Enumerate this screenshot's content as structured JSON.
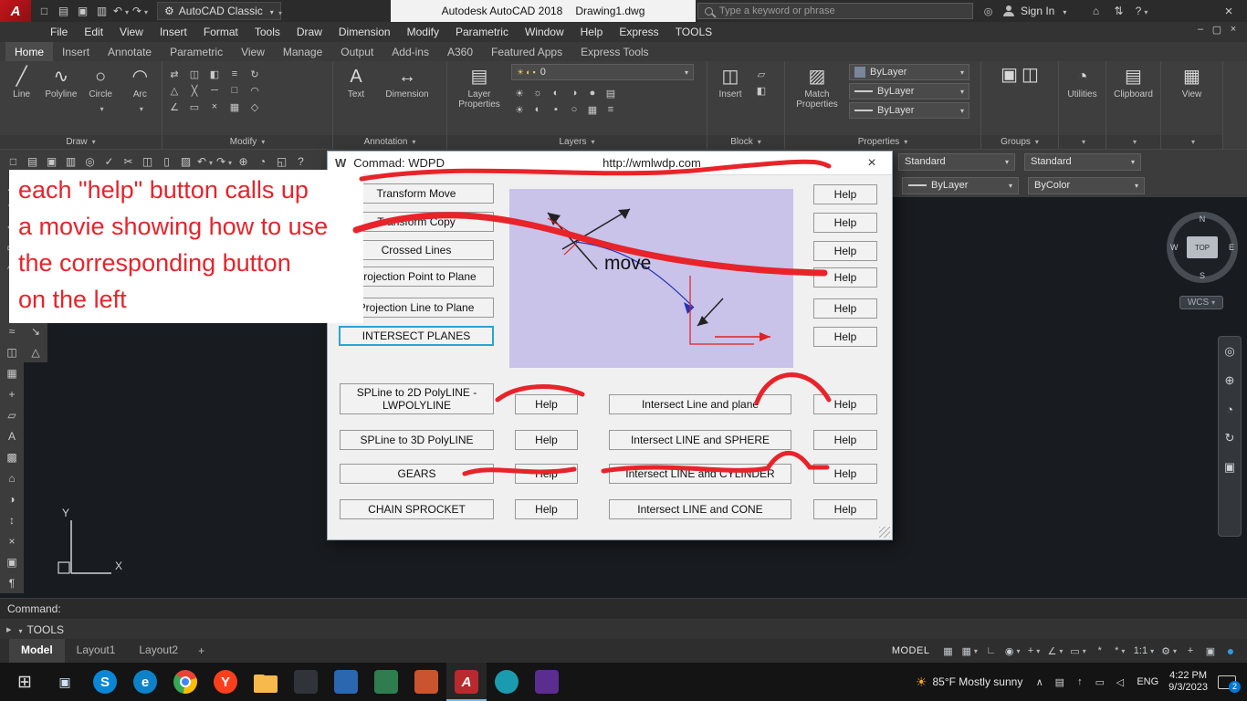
{
  "titlebar": {
    "logo": "A",
    "quick_icons": [
      {
        "glyph": "□",
        "name": "new-file-icon"
      },
      {
        "glyph": "▤",
        "name": "open-file-icon"
      },
      {
        "glyph": "▣",
        "name": "save-icon"
      },
      {
        "glyph": "▥",
        "name": "plot-icon"
      },
      {
        "glyph": "↶",
        "name": "undo-icon",
        "caret": 1
      },
      {
        "glyph": "↷",
        "name": "redo-icon",
        "caret": 1
      }
    ],
    "workspace": {
      "icon": "⚙",
      "label": "AutoCAD Classic"
    },
    "title": "Autodesk AutoCAD 2018",
    "filename": "Drawing1.dwg",
    "search_placeholder": "Type a keyword or phrase",
    "extra_icons": [
      {
        "glyph": "◎",
        "name": "exchange-apps-icon"
      }
    ],
    "signin_label": "Sign In",
    "right_icons": [
      {
        "glyph": "⌂",
        "name": "app-store-icon"
      },
      {
        "glyph": "⇅",
        "name": "stay-connected-icon"
      },
      {
        "glyph": "?",
        "name": "help-icon",
        "caret": 1
      }
    ]
  },
  "menubar": {
    "items": [
      {
        "label": "File",
        "name": "menu-file"
      },
      {
        "label": "Edit",
        "name": "menu-edit"
      },
      {
        "label": "View",
        "name": "menu-view"
      },
      {
        "label": "Insert",
        "name": "menu-insert"
      },
      {
        "label": "Format",
        "name": "menu-format"
      },
      {
        "label": "Tools",
        "name": "menu-tools"
      },
      {
        "label": "Draw",
        "name": "menu-draw"
      },
      {
        "label": "Dimension",
        "name": "menu-dimension"
      },
      {
        "label": "Modify",
        "name": "menu-modify"
      },
      {
        "label": "Parametric",
        "name": "menu-parametric"
      },
      {
        "label": "Window",
        "name": "menu-window"
      },
      {
        "label": "Help",
        "name": "menu-help"
      },
      {
        "label": "Express",
        "name": "menu-express"
      },
      {
        "label": "TOOLS",
        "name": "menu-tools-custom"
      }
    ]
  },
  "ribbon": {
    "tabs": [
      {
        "label": "Home",
        "name": "tab-home",
        "active": true
      },
      {
        "label": "Insert",
        "name": "tab-insert"
      },
      {
        "label": "Annotate",
        "name": "tab-annotate"
      },
      {
        "label": "Parametric",
        "name": "tab-parametric"
      },
      {
        "label": "View",
        "name": "tab-view"
      },
      {
        "label": "Manage",
        "name": "tab-manage"
      },
      {
        "label": "Output",
        "name": "tab-output"
      },
      {
        "label": "Add-ins",
        "name": "tab-add-ins"
      },
      {
        "label": "A360",
        "name": "tab-a360"
      },
      {
        "label": "Featured Apps",
        "name": "tab-featured-apps"
      },
      {
        "label": "Express Tools",
        "name": "tab-express-tools"
      }
    ],
    "panels": {
      "draw": {
        "label": "Draw",
        "tools": [
          {
            "glyph": "╱",
            "label": "Line"
          },
          {
            "glyph": "∿",
            "label": "Polyline"
          },
          {
            "glyph": "○",
            "label": "Circle",
            "caret": 1
          },
          {
            "glyph": "◠",
            "label": "Arc",
            "caret": 1
          }
        ],
        "small": [
          {
            "glyph": "▭",
            "name": "rectangle-icon"
          },
          {
            "glyph": "◇",
            "name": "polygon-icon"
          },
          {
            "glyph": "◌",
            "name": "ellipse-icon"
          },
          {
            "glyph": "≈",
            "name": "hatch-icon"
          },
          {
            "glyph": "◠",
            "name": "revcloud-icon"
          },
          {
            "glyph": "∿",
            "name": "spline-icon"
          }
        ]
      },
      "modify": {
        "label": "Modify",
        "small": [
          {
            "glyph": "⇄",
            "name": "move-icon"
          },
          {
            "glyph": "◫",
            "name": "copy-icon"
          },
          {
            "glyph": "◧",
            "name": "mirror-icon"
          },
          {
            "glyph": "≡",
            "name": "array-icon"
          },
          {
            "glyph": "↻",
            "name": "rotate-icon"
          },
          {
            "glyph": "△",
            "name": "scale-icon"
          },
          {
            "glyph": "╳",
            "name": "trim-icon"
          },
          {
            "glyph": "─",
            "name": "extend-icon"
          },
          {
            "glyph": "□",
            "name": "stretch-icon"
          },
          {
            "glyph": "◠",
            "name": "fillet-icon"
          },
          {
            "glyph": "∠",
            "name": "chamfer-icon"
          },
          {
            "glyph": "▭",
            "name": "explode-icon"
          },
          {
            "glyph": "×",
            "name": "erase-icon"
          },
          {
            "glyph": "▦",
            "name": "offset-icon"
          },
          {
            "glyph": "◇",
            "name": "join-icon"
          }
        ]
      },
      "annotation": {
        "label": "Annotation",
        "text_glyph": "A",
        "text_label": "Text",
        "dim_glyph": "↔",
        "dim_label": "Dimension"
      },
      "layers": {
        "label": "Layers",
        "big_glyph": "▤",
        "big_label": "Layer Properties",
        "layer_value": "0",
        "combo_icons": [
          {
            "glyph": "☀",
            "name": "layer-on-icon"
          },
          {
            "glyph": "◐",
            "name": "layer-freeze-icon"
          },
          {
            "glyph": "▪",
            "name": "layer-color-icon"
          }
        ],
        "small": [
          {
            "glyph": "☀",
            "name": "layer-tool-icon"
          },
          {
            "glyph": "☼",
            "name": "layer-tool-icon"
          },
          {
            "glyph": "◐",
            "name": "layer-tool-icon"
          },
          {
            "glyph": "◑",
            "name": "layer-tool-icon"
          },
          {
            "glyph": "●",
            "name": "layer-tool-icon"
          },
          {
            "glyph": "▤",
            "name": "layer-tool-icon"
          },
          {
            "glyph": "☀",
            "name": "layer-tool-icon"
          },
          {
            "glyph": "◐",
            "name": "layer-tool-icon"
          },
          {
            "glyph": "▪",
            "name": "layer-tool-icon"
          },
          {
            "glyph": "○",
            "name": "layer-tool-icon"
          },
          {
            "glyph": "▦",
            "name": "layer-tool-icon"
          },
          {
            "glyph": "≡",
            "name": "layer-tool-icon"
          }
        ]
      },
      "block": {
        "label": "Block",
        "big_glyph": "◫",
        "big_label": "Insert",
        "small": [
          {
            "glyph": "▱",
            "name": "edit-attribute-icon"
          },
          {
            "glyph": "◧",
            "name": "create-block-icon"
          }
        ]
      },
      "properties": {
        "label": "Properties",
        "big_glyph": "▨",
        "big_label": "Match Properties",
        "combos": [
          "ByLayer",
          "ByLayer",
          "ByLayer"
        ]
      },
      "groups": {
        "label": "Groups",
        "icons": [
          {
            "glyph": "▣",
            "name": "group-icon"
          },
          {
            "glyph": "◫",
            "name": "ungroup-icon"
          }
        ]
      },
      "utilities": {
        "label": "Utilities",
        "glyph": "◔"
      },
      "clipboard": {
        "label": "Clipboard",
        "glyph": "▤"
      },
      "view": {
        "label": "View",
        "glyph": "▦"
      }
    }
  },
  "toolbars": {
    "row1_icons": [
      {
        "glyph": "□",
        "name": "qnew-icon"
      },
      {
        "glyph": "▤",
        "name": "open-icon"
      },
      {
        "glyph": "▣",
        "name": "qsave-icon"
      },
      {
        "glyph": "▥",
        "name": "plot-icon"
      },
      {
        "glyph": "◎",
        "name": "plot-preview-icon"
      },
      {
        "glyph": "✓",
        "name": "spell-check-icon"
      },
      {
        "glyph": "✂",
        "name": "cut-icon"
      },
      {
        "glyph": "◫",
        "name": "copy-clip-icon"
      },
      {
        "glyph": "▯",
        "name": "paste-icon"
      },
      {
        "glyph": "▨",
        "name": "match-properties-icon"
      },
      {
        "glyph": "↶",
        "name": "undo-icon",
        "caret": 1
      },
      {
        "glyph": "↷",
        "name": "redo-icon",
        "caret": 1
      },
      {
        "glyph": "⊕",
        "name": "pan-icon"
      },
      {
        "glyph": "◔",
        "name": "zoom-realtime-icon"
      },
      {
        "glyph": "◱",
        "name": "zoom-window-icon"
      },
      {
        "glyph": "?",
        "name": "help-icon"
      }
    ],
    "standard1": "Standard",
    "standard2": "Standard",
    "bylayer": "ByLayer",
    "bycolor": "ByColor",
    "left_col1": [
      {
        "glyph": "╱",
        "name": "line-icon"
      },
      {
        "glyph": "∿",
        "name": "polyline-icon"
      },
      {
        "glyph": "◇",
        "name": "polygon-icon"
      },
      {
        "glyph": "▭",
        "name": "rectangle-icon"
      },
      {
        "glyph": "◠",
        "name": "arc-icon"
      },
      {
        "glyph": "○",
        "name": "circle-icon"
      },
      {
        "glyph": "◌",
        "name": "ellipse-icon"
      },
      {
        "glyph": "≈",
        "name": "hatch-icon"
      },
      {
        "glyph": "◫",
        "name": "insert-block-icon"
      },
      {
        "glyph": "▦",
        "name": "table-icon"
      },
      {
        "glyph": "+",
        "name": "point-icon"
      },
      {
        "glyph": "▱",
        "name": "region-icon"
      },
      {
        "glyph": "A",
        "name": "mtext-icon"
      },
      {
        "glyph": "▩",
        "name": "gradient-icon"
      },
      {
        "glyph": "⌂",
        "name": "revcloud-icon"
      },
      {
        "glyph": "◑",
        "name": "donut-icon"
      },
      {
        "glyph": "↕",
        "name": "construction-line-icon"
      },
      {
        "glyph": "×",
        "name": "erase-icon"
      },
      {
        "glyph": "▣",
        "name": "style-icon"
      },
      {
        "glyph": "¶",
        "name": "text-style-icon"
      }
    ],
    "left_col2": [
      {
        "glyph": "×",
        "name": "erase-icon"
      },
      {
        "glyph": "◫",
        "name": "copy-icon"
      },
      {
        "glyph": "◧",
        "name": "mirror-icon"
      },
      {
        "glyph": "≡",
        "name": "offset-icon"
      },
      {
        "glyph": "▦",
        "name": "array-icon"
      },
      {
        "glyph": "⇄",
        "name": "move-icon"
      },
      {
        "glyph": "↻",
        "name": "rotate-icon"
      },
      {
        "glyph": "↘",
        "name": "stretch-icon"
      },
      {
        "glyph": "△",
        "name": "scale-icon"
      }
    ]
  },
  "dialog": {
    "icon": "W",
    "title": "Commad: WDPD",
    "url": "http://wmlwdp.com",
    "help_label": "Help",
    "buttons_left": [
      {
        "label": "Transform Move"
      },
      {
        "label": "Transform Copy"
      },
      {
        "label": "Crossed Lines"
      },
      {
        "label": "Projection Point to Plane"
      },
      {
        "label": "Projection Line to Plane"
      },
      {
        "label": "INTERSECT PLANES"
      }
    ],
    "preview_caption": "move",
    "rows": [
      {
        "left1": "SPLine to 2D PolyLINE  -",
        "left2": "LWPOLYLINE",
        "right": "Intersect Line and plane"
      },
      {
        "left1": "SPLine to 3D PolyLINE",
        "right": "Intersect LINE and SPHERE"
      },
      {
        "left1": "GEARS",
        "right": "Intersect LINE and CYLINDER"
      },
      {
        "left1": "CHAIN SPROCKET",
        "right": "Intersect LINE and CONE"
      }
    ]
  },
  "annotation": {
    "lines": [
      "each \"help\" button calls up",
      "a movie showing how to use",
      "the corresponding button",
      "on the left"
    ]
  },
  "canvas": {
    "compass": {
      "n": "N",
      "e": "E",
      "s": "S",
      "w": "W",
      "center": "TOP"
    },
    "wcs_label": "WCS",
    "ucs_x": "X",
    "ucs_y": "Y",
    "navbar": [
      {
        "glyph": "◎",
        "name": "steering-wheel-icon"
      },
      {
        "glyph": "⊕",
        "name": "pan-icon"
      },
      {
        "glyph": "◔",
        "name": "zoom-icon"
      },
      {
        "glyph": "↻",
        "name": "orbit-icon"
      },
      {
        "glyph": "▣",
        "name": "showmotion-icon"
      }
    ]
  },
  "commandline": {
    "prompt": "Command:",
    "icon": "▸",
    "input": "TOOLS"
  },
  "statusbar": {
    "tabs": [
      {
        "label": "Model",
        "name": "tab-model",
        "active": true
      },
      {
        "label": "Layout1",
        "name": "tab-layout1"
      },
      {
        "label": "Layout2",
        "name": "tab-layout2"
      }
    ],
    "add_tab": "+",
    "model_label": "MODEL",
    "icons": [
      {
        "glyph": "▦",
        "name": "grid-display-icon"
      },
      {
        "glyph": "▦",
        "caret": 1,
        "name": "snap-mode-icon"
      },
      {
        "glyph": "∟",
        "name": "ortho-mode-icon"
      },
      {
        "glyph": "◉",
        "caret": 1,
        "name": "isometric-drafting-icon"
      },
      {
        "glyph": "+",
        "caret": 1,
        "name": "object-snap-icon"
      },
      {
        "glyph": "∠",
        "caret": 1,
        "name": "polar-tracking-icon"
      },
      {
        "glyph": "▭",
        "caret": 1,
        "name": "dynamic-input-icon"
      },
      {
        "glyph": "*",
        "name": "annotation-visibility-icon"
      },
      {
        "glyph": "*",
        "caret": 1,
        "name": "annotation-autoscale-icon"
      },
      {
        "glyph": "1:1",
        "caret": 1,
        "name": "annotation-scale-button",
        "class": "wide"
      },
      {
        "glyph": "⚙",
        "caret": 1,
        "name": "workspace-switching-icon"
      },
      {
        "glyph": "+",
        "name": "customize-plus-icon"
      },
      {
        "glyph": "▣",
        "name": "clean-screen-icon"
      },
      {
        "glyph": "●",
        "name": "status-notification-dot",
        "class": "blue"
      }
    ]
  },
  "taskbar": {
    "apps": [
      {
        "glyph": "⊞",
        "name": "start-button",
        "class": "start"
      },
      {
        "glyph": "▣",
        "name": "task-view-icon",
        "class": "plain"
      },
      {
        "glyph": "S",
        "name": "skype-icon",
        "class": "circ",
        "bg": "#0a86d6"
      },
      {
        "glyph": "e",
        "name": "edge-icon",
        "class": "circ",
        "bg": "#0c82c8"
      },
      {
        "glyph": "",
        "name": "chrome-icon",
        "class": "chrome"
      },
      {
        "glyph": "Y",
        "name": "yandex-browser-icon",
        "class": "circ",
        "bg": "#fb3f1d"
      },
      {
        "glyph": "",
        "name": "file-explorer-icon",
        "class": "folder"
      },
      {
        "glyph": "",
        "name": "app-icon-1",
        "class": "tile",
        "bg": "#30343a"
      },
      {
        "glyph": "",
        "name": "app-icon-2",
        "class": "tile",
        "bg": "#2b66b1"
      },
      {
        "glyph": "",
        "name": "app-icon-3",
        "class": "tile",
        "bg": "#2f7d4f"
      },
      {
        "glyph": "",
        "name": "app-icon-4",
        "class": "tile",
        "bg": "#c9542f"
      },
      {
        "glyph": "A",
        "name": "autocad-icon",
        "class": "tile acad",
        "bg": "#b3181d",
        "active": true
      },
      {
        "glyph": "",
        "name": "app-icon-5",
        "class": "circ",
        "bg": "#1b9bb0"
      },
      {
        "glyph": "",
        "name": "app-icon-6",
        "class": "tile",
        "bg": "#5c2d91"
      }
    ],
    "weather_icon": "☀",
    "weather": "85°F Mostly sunny",
    "tray_icons": [
      {
        "glyph": "∧",
        "name": "hidden-icons-chevron"
      },
      {
        "glyph": "▤",
        "name": "touch-keyboard-icon"
      },
      {
        "glyph": "↑",
        "name": "upload-status-icon"
      },
      {
        "glyph": "▭",
        "name": "display-icon"
      },
      {
        "glyph": "◁",
        "name": "volume-icon"
      }
    ],
    "lang": "ENG",
    "time": "4:22 PM",
    "date": "9/3/2023",
    "badge": "2"
  },
  "colors": {
    "annotation_red": "#e8232a",
    "preview_lavender": "#c9c2e9",
    "autocad_red": "#b3181d",
    "focus_blue": "#2aa3d4"
  }
}
